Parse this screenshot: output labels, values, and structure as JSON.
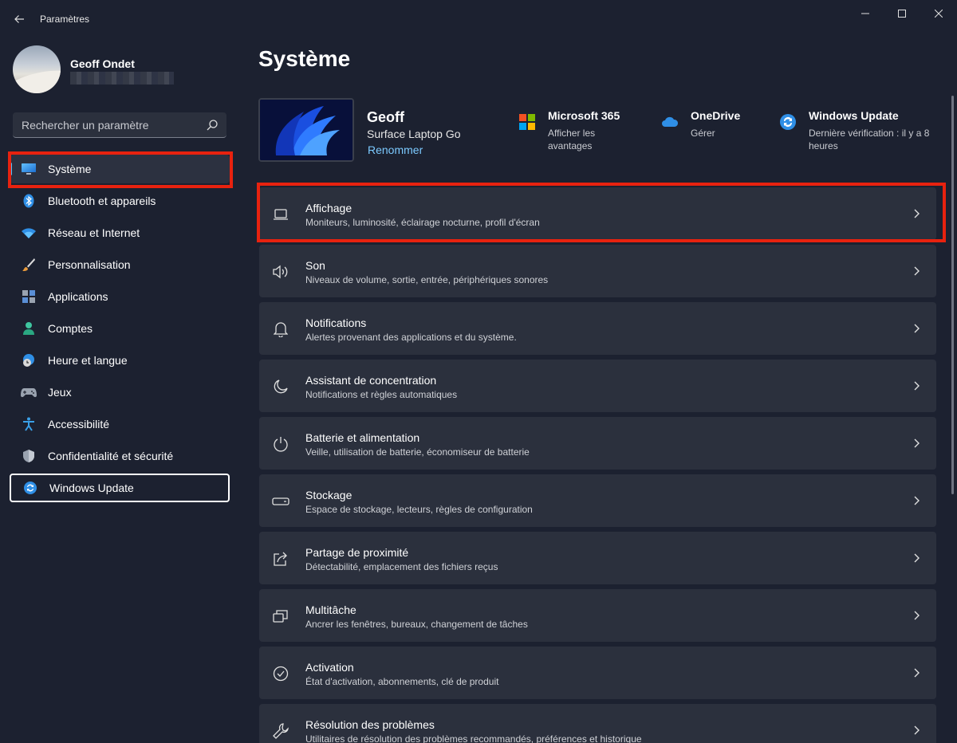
{
  "window": {
    "title": "Paramètres",
    "controls": [
      "minimize-icon",
      "maximize-icon",
      "close-icon"
    ]
  },
  "user": {
    "name": "Geoff Ondet"
  },
  "search": {
    "placeholder": "Rechercher un paramètre"
  },
  "sidebar": {
    "items": [
      {
        "label": "Système",
        "icon": "monitor-icon",
        "active": true
      },
      {
        "label": "Bluetooth et appareils",
        "icon": "bluetooth-icon"
      },
      {
        "label": "Réseau et Internet",
        "icon": "wifi-icon"
      },
      {
        "label": "Personnalisation",
        "icon": "brush-icon"
      },
      {
        "label": "Applications",
        "icon": "apps-icon"
      },
      {
        "label": "Comptes",
        "icon": "person-icon"
      },
      {
        "label": "Heure et langue",
        "icon": "globe-clock-icon"
      },
      {
        "label": "Jeux",
        "icon": "gamepad-icon"
      },
      {
        "label": "Accessibilité",
        "icon": "accessibility-icon"
      },
      {
        "label": "Confidentialité et sécurité",
        "icon": "shield-icon"
      },
      {
        "label": "Windows Update",
        "icon": "windows-update-icon",
        "focused": true
      }
    ]
  },
  "main": {
    "title": "Système",
    "device": {
      "name": "Geoff",
      "model": "Surface Laptop Go",
      "rename_label": "Renommer"
    },
    "quick_links": [
      {
        "title": "Microsoft 365",
        "subtitle": "Afficher les avantages",
        "icon": "microsoft-logo-icon"
      },
      {
        "title": "OneDrive",
        "subtitle": "Gérer",
        "icon": "onedrive-cloud-icon"
      },
      {
        "title": "Windows Update",
        "subtitle": "Dernière vérification : il y a 8 heures",
        "icon": "windows-update-icon"
      }
    ],
    "cards": [
      {
        "title": "Affichage",
        "subtitle": "Moniteurs, luminosité, éclairage nocturne, profil d'écran",
        "icon": "laptop-icon"
      },
      {
        "title": "Son",
        "subtitle": "Niveaux de volume, sortie, entrée, périphériques sonores",
        "icon": "speaker-icon"
      },
      {
        "title": "Notifications",
        "subtitle": "Alertes provenant des applications et du système.",
        "icon": "bell-icon"
      },
      {
        "title": "Assistant de concentration",
        "subtitle": "Notifications et règles automatiques",
        "icon": "moon-icon"
      },
      {
        "title": "Batterie et alimentation",
        "subtitle": "Veille, utilisation de batterie, économiseur de batterie",
        "icon": "power-icon"
      },
      {
        "title": "Stockage",
        "subtitle": "Espace de stockage, lecteurs, règles de configuration",
        "icon": "drive-icon"
      },
      {
        "title": "Partage de proximité",
        "subtitle": "Détectabilité, emplacement des fichiers reçus",
        "icon": "share-icon"
      },
      {
        "title": "Multitâche",
        "subtitle": "Ancrer les fenêtres, bureaux, changement de tâches",
        "icon": "multitask-icon"
      },
      {
        "title": "Activation",
        "subtitle": "État d'activation, abonnements, clé de produit",
        "icon": "check-circle-icon"
      },
      {
        "title": "Résolution des problèmes",
        "subtitle": "Utilitaires de résolution des problèmes recommandés, préférences et historique",
        "icon": "wrench-icon"
      }
    ]
  },
  "colors": {
    "background": "#1c2130",
    "card": "#2b303d",
    "accent": "#4cc2ff",
    "highlight_box": "#e8220f",
    "link": "#7ccaff"
  }
}
